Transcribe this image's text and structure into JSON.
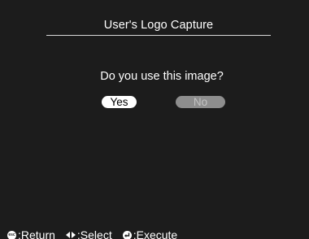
{
  "dialog": {
    "title": "User's Logo Capture",
    "question": "Do you use this image?",
    "buttons": {
      "yes_label": "Yes",
      "no_label": "No"
    }
  },
  "footer": {
    "esc_icon_text": "esc",
    "return_label": ":Return",
    "select_label": ":Select",
    "execute_label": ":Execute"
  }
}
